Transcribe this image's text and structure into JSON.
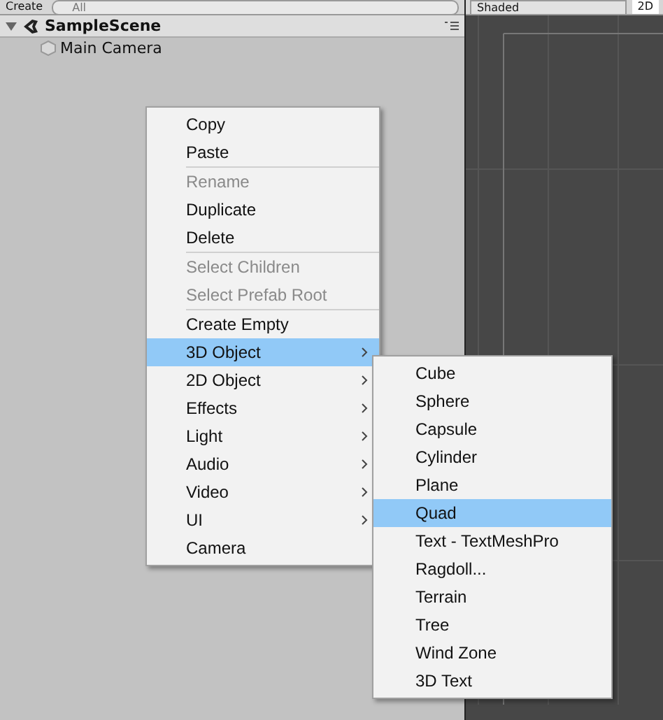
{
  "toolbar": {
    "create_label": "Create",
    "search_placeholder": "All",
    "shading_mode": "Shaded",
    "view_toggle": "2D"
  },
  "hierarchy": {
    "scene": {
      "name": "SampleScene",
      "expanded": true
    },
    "objects": [
      {
        "name": "Main Camera"
      }
    ]
  },
  "context_menu": {
    "items": [
      {
        "kind": "item",
        "label": "Copy",
        "disabled": false,
        "selected": false,
        "submenu": false
      },
      {
        "kind": "item",
        "label": "Paste",
        "disabled": false,
        "selected": false,
        "submenu": false
      },
      {
        "kind": "separator"
      },
      {
        "kind": "item",
        "label": "Rename",
        "disabled": true,
        "selected": false,
        "submenu": false
      },
      {
        "kind": "item",
        "label": "Duplicate",
        "disabled": false,
        "selected": false,
        "submenu": false
      },
      {
        "kind": "item",
        "label": "Delete",
        "disabled": false,
        "selected": false,
        "submenu": false
      },
      {
        "kind": "separator"
      },
      {
        "kind": "item",
        "label": "Select Children",
        "disabled": true,
        "selected": false,
        "submenu": false
      },
      {
        "kind": "item",
        "label": "Select Prefab Root",
        "disabled": true,
        "selected": false,
        "submenu": false
      },
      {
        "kind": "separator"
      },
      {
        "kind": "item",
        "label": "Create Empty",
        "disabled": false,
        "selected": false,
        "submenu": false
      },
      {
        "kind": "item",
        "label": "3D Object",
        "disabled": false,
        "selected": true,
        "submenu": true
      },
      {
        "kind": "item",
        "label": "2D Object",
        "disabled": false,
        "selected": false,
        "submenu": true
      },
      {
        "kind": "item",
        "label": "Effects",
        "disabled": false,
        "selected": false,
        "submenu": true
      },
      {
        "kind": "item",
        "label": "Light",
        "disabled": false,
        "selected": false,
        "submenu": true
      },
      {
        "kind": "item",
        "label": "Audio",
        "disabled": false,
        "selected": false,
        "submenu": true
      },
      {
        "kind": "item",
        "label": "Video",
        "disabled": false,
        "selected": false,
        "submenu": true
      },
      {
        "kind": "item",
        "label": "UI",
        "disabled": false,
        "selected": false,
        "submenu": true
      },
      {
        "kind": "item",
        "label": "Camera",
        "disabled": false,
        "selected": false,
        "submenu": false
      }
    ]
  },
  "submenu": {
    "items": [
      {
        "label": "Cube",
        "selected": false
      },
      {
        "label": "Sphere",
        "selected": false
      },
      {
        "label": "Capsule",
        "selected": false
      },
      {
        "label": "Cylinder",
        "selected": false
      },
      {
        "label": "Plane",
        "selected": false
      },
      {
        "label": "Quad",
        "selected": true
      },
      {
        "label": "Text - TextMeshPro",
        "selected": false
      },
      {
        "label": "Ragdoll...",
        "selected": false
      },
      {
        "label": "Terrain",
        "selected": false
      },
      {
        "label": "Tree",
        "selected": false
      },
      {
        "label": "Wind Zone",
        "selected": false
      },
      {
        "label": "3D Text",
        "selected": false
      }
    ]
  }
}
